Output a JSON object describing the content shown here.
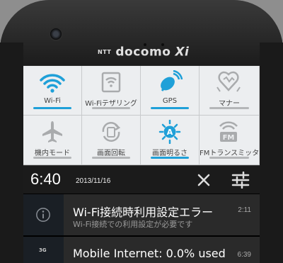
{
  "device": {
    "brand_prefix": "NTT",
    "brand_name": "docomo",
    "brand_suffix": "Xi"
  },
  "quick_settings": [
    {
      "label": "Wi-Fi",
      "icon": "wifi-icon",
      "active": true
    },
    {
      "label": "Wi-Fiテザリング",
      "icon": "tethering-icon",
      "active": false
    },
    {
      "label": "GPS",
      "icon": "gps-icon",
      "active": true
    },
    {
      "label": "マナー",
      "icon": "manner-mode-icon",
      "active": false
    },
    {
      "label": "機内モード",
      "icon": "airplane-icon",
      "active": false
    },
    {
      "label": "画面回転",
      "icon": "rotate-icon",
      "active": false
    },
    {
      "label": "画面明るさ",
      "icon": "brightness-icon",
      "active": true
    },
    {
      "label": "FMトランスミッタ",
      "icon": "fm-transmitter-icon",
      "active": false
    }
  ],
  "status": {
    "time": "6:40",
    "date": "2013/11/16"
  },
  "notifications": [
    {
      "icon": "info-icon",
      "title": "Wi-Fi接続時利用設定エラー",
      "subtitle": "Wi-Fi接続での利用設定が必要です",
      "time": "2:11"
    },
    {
      "icon": "3g-icon",
      "icon_text": "3G",
      "title": "Mobile Internet: 0.0% used",
      "subtitle": "",
      "time": "6:39"
    }
  ],
  "colors": {
    "accent": "#1fa0d8",
    "inactive_icon": "#a9abad",
    "panel_bg": "#e9ebed",
    "notification_bg": "#2a2a2a"
  }
}
